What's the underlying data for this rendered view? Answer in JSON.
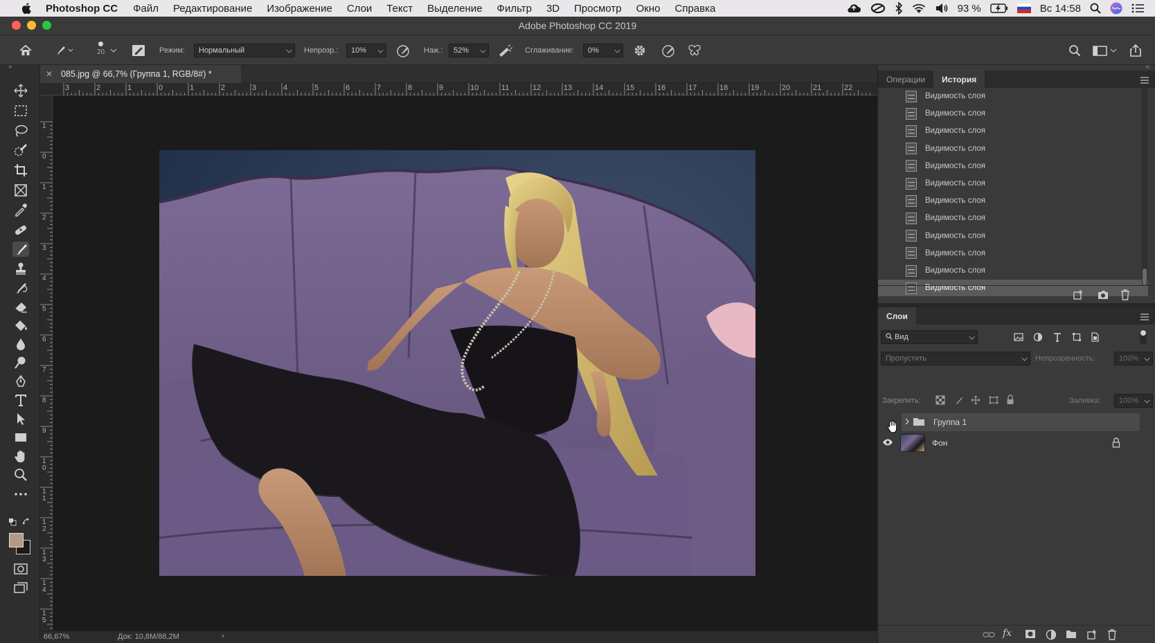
{
  "menubar": {
    "app_name": "Photoshop CC",
    "items": [
      "Файл",
      "Редактирование",
      "Изображение",
      "Слои",
      "Текст",
      "Выделение",
      "Фильтр",
      "3D",
      "Просмотр",
      "Окно",
      "Справка"
    ],
    "battery": "93 %",
    "clock": "Вс 14:58"
  },
  "window": {
    "title": "Adobe Photoshop CC 2019"
  },
  "options": {
    "brush_size": "20",
    "mode_label": "Режим:",
    "mode_value": "Нормальный",
    "opacity_label": "Непрозр.:",
    "opacity_value": "10%",
    "flow_label": "Наж.:",
    "flow_value": "52%",
    "smoothing_label": "Сглаживание:",
    "smoothing_value": "0%"
  },
  "document": {
    "tab_label": "085.jpg @ 66,7% (Группа 1, RGB/8#) *",
    "zoom": "66,67%",
    "doc_info": "Док: 10,8M/88,2M"
  },
  "ruler": {
    "h_labels": [
      "3",
      "2",
      "1",
      "0",
      "1",
      "2",
      "3",
      "4",
      "5",
      "6",
      "7",
      "8",
      "9",
      "10",
      "11",
      "12",
      "13",
      "14",
      "15",
      "16",
      "17",
      "18",
      "19",
      "20",
      "21",
      "22"
    ],
    "v_labels": [
      "1",
      "0",
      "1",
      "2",
      "3",
      "4",
      "5",
      "6",
      "7",
      "8",
      "9",
      "10",
      "11",
      "12",
      "13",
      "14",
      "15"
    ]
  },
  "history_panel": {
    "tabs": [
      "Операции",
      "История"
    ],
    "active_tab": "История",
    "items": [
      "Видимость слоя",
      "Видимость слоя",
      "Видимость слоя",
      "Видимость слоя",
      "Видимость слоя",
      "Видимость слоя",
      "Видимость слоя",
      "Видимость слоя",
      "Видимость слоя",
      "Видимость слоя",
      "Видимость слоя",
      "Видимость слоя"
    ],
    "selected_index": 11
  },
  "layers_panel": {
    "title": "Слои",
    "filter_value": "Вид",
    "blend_mode": "Пропустить",
    "opacity_label": "Непрозрачность:",
    "opacity_value": "100%",
    "lock_label": "Закрепить:",
    "fill_label": "Заливка:",
    "fill_value": "100%",
    "layers": [
      {
        "name": "Группа 1",
        "type": "group",
        "visible": false
      },
      {
        "name": "Фон",
        "type": "pixel",
        "visible": true,
        "locked": true
      }
    ]
  },
  "colors": {
    "foreground": "#b59a85",
    "background": "#1a1a1a",
    "accent_close": "#ff5f57",
    "accent_min": "#febc2e",
    "accent_max": "#28c840"
  }
}
